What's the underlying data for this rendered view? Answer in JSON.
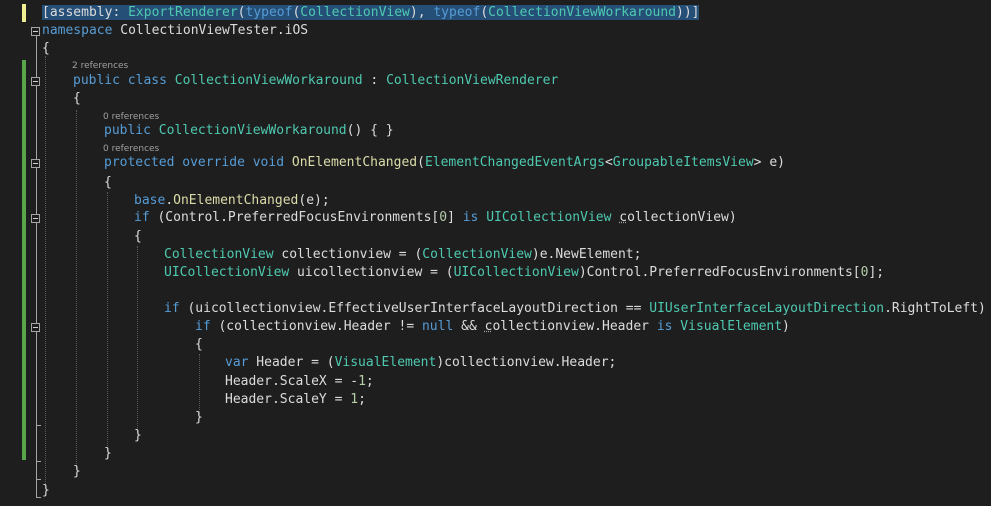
{
  "editor": {
    "lines": {
      "assembly": [
        "[assembly: ",
        "ExportRenderer",
        "(",
        "typeof",
        "(",
        "CollectionView",
        "), ",
        "typeof",
        "(",
        "CollectionViewWorkaround",
        "))]"
      ],
      "namespace": [
        "namespace",
        " CollectionViewTester.iOS"
      ],
      "open1": "{",
      "refs_class": "2 references",
      "class_decl": [
        "public",
        " ",
        "class",
        " ",
        "CollectionViewWorkaround",
        " : ",
        "CollectionViewRenderer"
      ],
      "open2": "{",
      "refs_ctor": "0 references",
      "ctor": [
        "public",
        " ",
        "CollectionViewWorkaround",
        "() { }"
      ],
      "refs_method": "0 references",
      "method": [
        "protected",
        " ",
        "override",
        " ",
        "void",
        " ",
        "OnElementChanged",
        "(",
        "ElementChangedEventArgs",
        "<",
        "GroupableItemsView",
        "> e)"
      ],
      "open3": "{",
      "base_call": [
        "base",
        ".",
        "OnElementChanged",
        "(e);"
      ],
      "if1": [
        "if",
        " (Control.PreferredFocusEnvironments[",
        "0",
        "] ",
        "is",
        " ",
        "UICollectionView",
        " ",
        "c",
        "ollectionView)"
      ],
      "open4": "{",
      "cv_decl": [
        "CollectionView",
        " collectionview = (",
        "CollectionView",
        ")e.NewElement;"
      ],
      "uicv_decl": [
        "UICollectionView",
        " uicollectionview = (",
        "UICollectionView",
        ")Control.PreferredFocusEnvironments[",
        "0",
        "];"
      ],
      "if2": [
        "if",
        " (uicollectionview.EffectiveUserInterfaceLayoutDirection == ",
        "UIUserInterfaceLayoutDirection",
        ".RightToLeft)"
      ],
      "if3": [
        "if",
        " (collectionview.Header != ",
        "null",
        " && ",
        "c",
        "ollectionview.Header ",
        "is",
        " ",
        "VisualElement",
        ")"
      ],
      "open5": "{",
      "var_header": [
        "var",
        " Header = (",
        "VisualElement",
        ")collectionview.Header;"
      ],
      "scalex": [
        "Header.ScaleX = -",
        "1",
        ";"
      ],
      "scaley": [
        "Header.ScaleY = ",
        "1",
        ";"
      ],
      "close5": "}",
      "close4": "}",
      "close3": "}",
      "close2": "}",
      "close1": "}"
    }
  }
}
